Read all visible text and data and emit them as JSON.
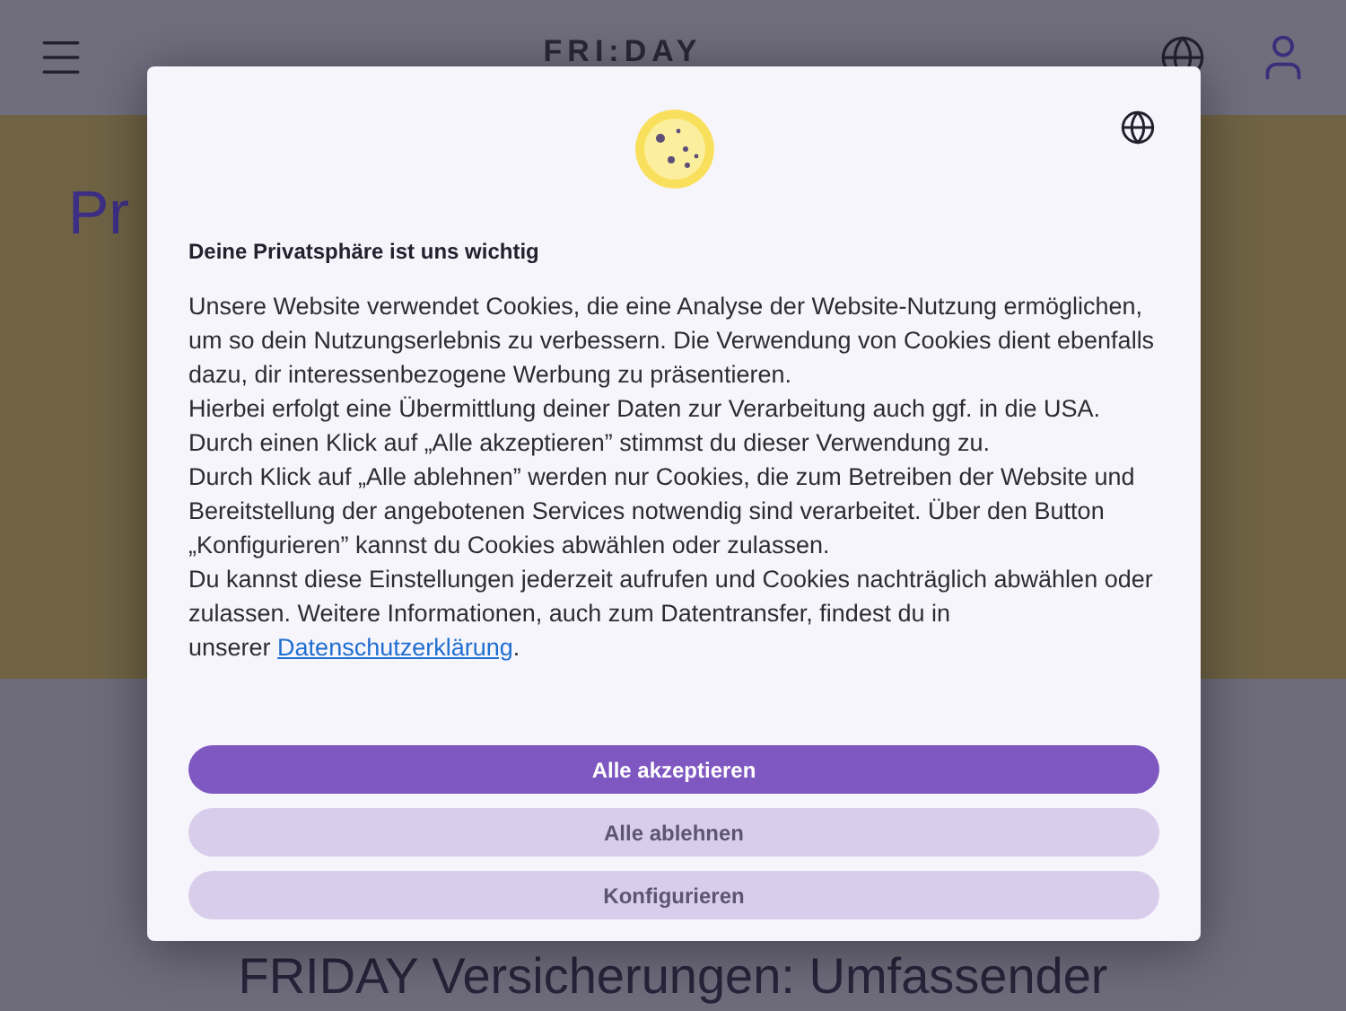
{
  "header": {
    "logo": "FRI:DAY"
  },
  "hero": {
    "title": "Pr"
  },
  "section": {
    "heading": "FRIDAY Versicherungen: Umfassender"
  },
  "dialog": {
    "title": "Deine Privatsphäre ist uns wichtig",
    "paragraphs": [
      "Unsere Website verwendet Cookies, die eine Analyse der Website-Nutzung ermöglichen, um so dein Nutzungserlebnis zu verbessern. Die Verwendung von Cookies dient ebenfalls dazu, dir interessenbezogene Werbung zu präsentieren.",
      "Hierbei erfolgt eine Übermittlung deiner Daten zur Verarbeitung auch ggf. in die USA.",
      "Durch einen Klick auf „Alle akzeptieren” stimmst du dieser Verwendung zu.",
      "Durch Klick auf „Alle ablehnen” werden nur Cookies, die zum Betreiben der Website und Bereitstellung der angebotenen Services notwendig sind verarbeitet. Über den Button „Konfigurieren” kannst du Cookies abwählen oder zulassen.",
      "Du kannst diese Einstellungen jederzeit aufrufen und Cookies nachträglich abwählen oder zulassen. Weitere Informationen, auch zum Datentransfer, findest du in"
    ],
    "link_prefix": "unserer",
    "link": "Datenschutzerklärung",
    "link_suffix": ".",
    "buttons": [
      {
        "label": "Alle akzeptieren",
        "kind": "primary"
      },
      {
        "label": "Alle ablehnen",
        "kind": "secondary"
      },
      {
        "label": "Konfigurieren",
        "kind": "secondary"
      }
    ]
  }
}
